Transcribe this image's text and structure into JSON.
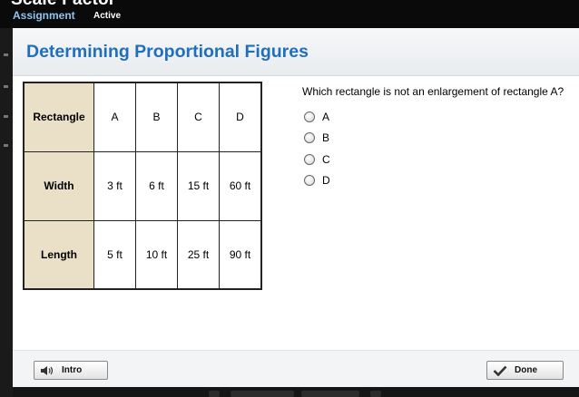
{
  "app": {
    "title": "Scale Factor",
    "assignment_label": "Assignment",
    "status": "Active"
  },
  "panel": {
    "title": "Determining Proportional Figures"
  },
  "table": {
    "rows": [
      {
        "header": "Rectangle",
        "cells": [
          "A",
          "B",
          "C",
          "D"
        ]
      },
      {
        "header": "Width",
        "cells": [
          "3 ft",
          "6 ft",
          "15 ft",
          "60 ft"
        ]
      },
      {
        "header": "Length",
        "cells": [
          "5 ft",
          "10 ft",
          "25 ft",
          "90 ft"
        ]
      }
    ]
  },
  "question": {
    "text": "Which rectangle is not an enlargement of rectangle A?",
    "options": [
      "A",
      "B",
      "C",
      "D"
    ]
  },
  "footer": {
    "intro_label": "Intro",
    "done_label": "Done"
  },
  "icons": {
    "intro": "speaker-icon",
    "done": "checkmark-icon"
  }
}
